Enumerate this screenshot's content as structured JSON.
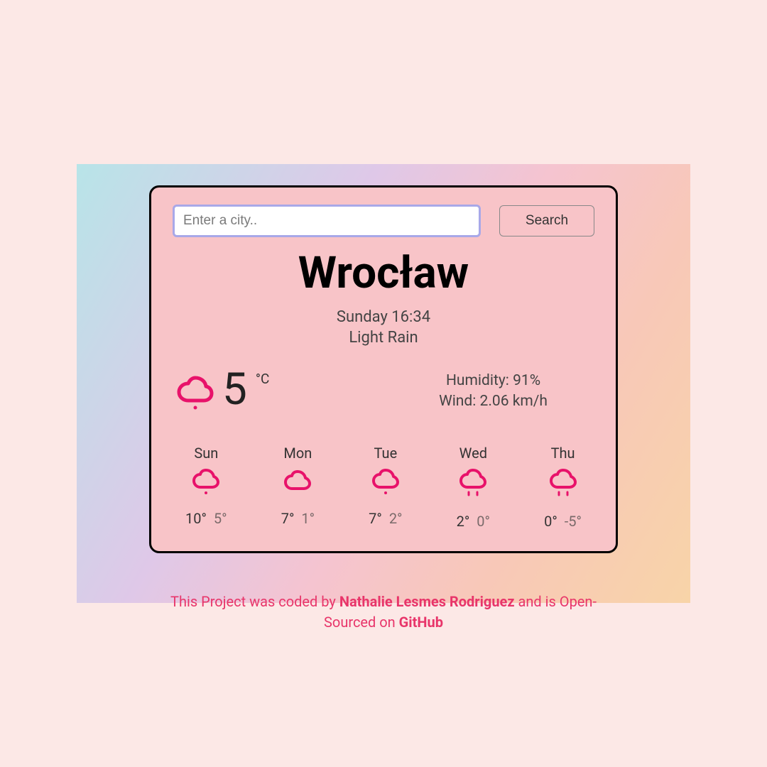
{
  "search": {
    "placeholder": "Enter a city..",
    "button_label": "Search"
  },
  "city": "Wrocław",
  "datetime": "Sunday 16:34",
  "condition": "Light Rain",
  "current": {
    "temp": "5",
    "unit": "°C",
    "humidity_label": "Humidity: ",
    "humidity_value": "91%",
    "wind_label": "Wind: ",
    "wind_value": "2.06 km/h"
  },
  "forecast": [
    {
      "day": "Sun",
      "high": "10°",
      "low": "5°",
      "icon": "rain"
    },
    {
      "day": "Mon",
      "high": "7°",
      "low": "1°",
      "icon": "cloud"
    },
    {
      "day": "Tue",
      "high": "7°",
      "low": "2°",
      "icon": "rain"
    },
    {
      "day": "Wed",
      "high": "2°",
      "low": "0°",
      "icon": "drizzle"
    },
    {
      "day": "Thu",
      "high": "0°",
      "low": "-5°",
      "icon": "drizzle"
    }
  ],
  "footer": {
    "prefix": "This Project was coded by ",
    "author": "Nathalie Lesmes Rodriguez",
    "middle": " and is Open-Sourced on ",
    "link": "GitHub"
  },
  "colors": {
    "icon_stroke": "#e8126a"
  }
}
